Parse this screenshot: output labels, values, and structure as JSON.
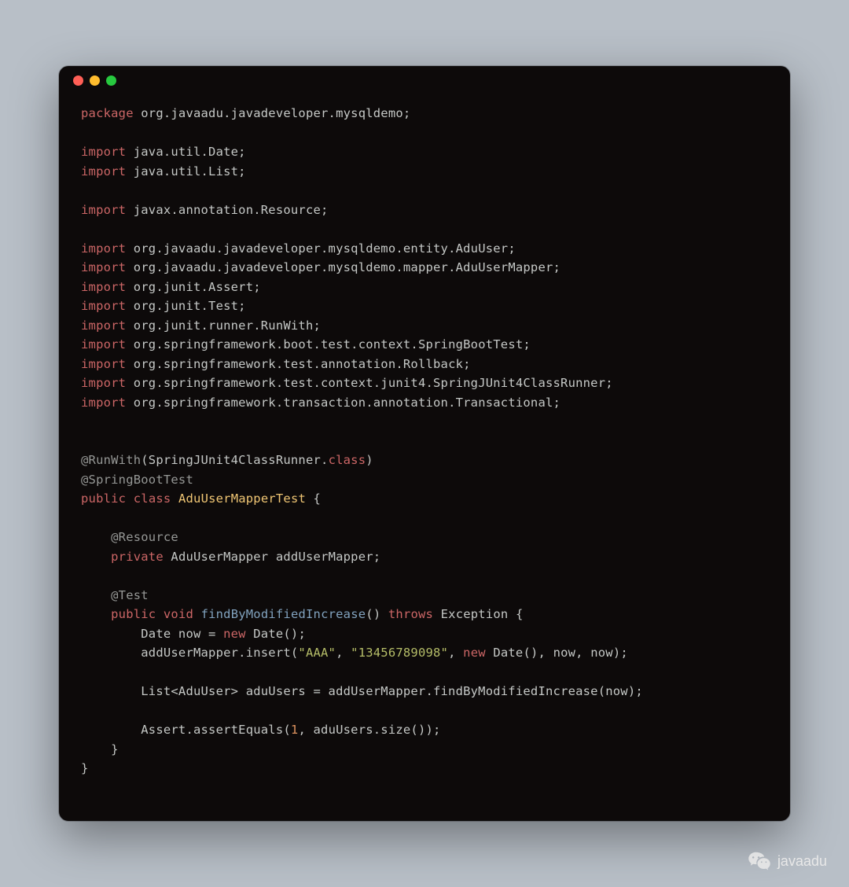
{
  "window": {
    "dots": [
      "red",
      "yellow",
      "green"
    ]
  },
  "code": {
    "lines": [
      [
        {
          "c": "kw-red",
          "t": "package"
        },
        {
          "c": "plain",
          "t": " org.javaadu.javadeveloper.mysqldemo;"
        }
      ],
      [],
      [
        {
          "c": "kw-red",
          "t": "import"
        },
        {
          "c": "plain",
          "t": " java.util.Date;"
        }
      ],
      [
        {
          "c": "kw-red",
          "t": "import"
        },
        {
          "c": "plain",
          "t": " java.util.List;"
        }
      ],
      [],
      [
        {
          "c": "kw-red",
          "t": "import"
        },
        {
          "c": "plain",
          "t": " javax.annotation.Resource;"
        }
      ],
      [],
      [
        {
          "c": "kw-red",
          "t": "import"
        },
        {
          "c": "plain",
          "t": " org.javaadu.javadeveloper.mysqldemo.entity.AduUser;"
        }
      ],
      [
        {
          "c": "kw-red",
          "t": "import"
        },
        {
          "c": "plain",
          "t": " org.javaadu.javadeveloper.mysqldemo.mapper.AduUserMapper;"
        }
      ],
      [
        {
          "c": "kw-red",
          "t": "import"
        },
        {
          "c": "plain",
          "t": " org.junit.Assert;"
        }
      ],
      [
        {
          "c": "kw-red",
          "t": "import"
        },
        {
          "c": "plain",
          "t": " org.junit.Test;"
        }
      ],
      [
        {
          "c": "kw-red",
          "t": "import"
        },
        {
          "c": "plain",
          "t": " org.junit.runner.RunWith;"
        }
      ],
      [
        {
          "c": "kw-red",
          "t": "import"
        },
        {
          "c": "plain",
          "t": " org.springframework.boot.test.context.SpringBootTest;"
        }
      ],
      [
        {
          "c": "kw-red",
          "t": "import"
        },
        {
          "c": "plain",
          "t": " org.springframework.test.annotation.Rollback;"
        }
      ],
      [
        {
          "c": "kw-red",
          "t": "import"
        },
        {
          "c": "plain",
          "t": " org.springframework.test.context.junit4.SpringJUnit4ClassRunner;"
        }
      ],
      [
        {
          "c": "kw-red",
          "t": "import"
        },
        {
          "c": "plain",
          "t": " org.springframework.transaction.annotation.Transactional;"
        }
      ],
      [],
      [],
      [
        {
          "c": "kw-dim",
          "t": "@RunWith"
        },
        {
          "c": "plain",
          "t": "(SpringJUnit4ClassRunner."
        },
        {
          "c": "kw-red",
          "t": "class"
        },
        {
          "c": "plain",
          "t": ")"
        }
      ],
      [
        {
          "c": "kw-dim",
          "t": "@SpringBootTest"
        }
      ],
      [
        {
          "c": "kw-red",
          "t": "public"
        },
        {
          "c": "plain",
          "t": " "
        },
        {
          "c": "kw-red",
          "t": "class"
        },
        {
          "c": "plain",
          "t": " "
        },
        {
          "c": "kw-yellow",
          "t": "AduUserMapperTest"
        },
        {
          "c": "plain",
          "t": " {"
        }
      ],
      [],
      [
        {
          "c": "plain",
          "t": "    "
        },
        {
          "c": "kw-dim",
          "t": "@Resource"
        }
      ],
      [
        {
          "c": "plain",
          "t": "    "
        },
        {
          "c": "kw-red",
          "t": "private"
        },
        {
          "c": "plain",
          "t": " AduUserMapper addUserMapper;"
        }
      ],
      [],
      [
        {
          "c": "plain",
          "t": "    "
        },
        {
          "c": "kw-dim",
          "t": "@Test"
        }
      ],
      [
        {
          "c": "plain",
          "t": "    "
        },
        {
          "c": "kw-red",
          "t": "public"
        },
        {
          "c": "plain",
          "t": " "
        },
        {
          "c": "kw-red",
          "t": "void"
        },
        {
          "c": "plain",
          "t": " "
        },
        {
          "c": "kw-blue",
          "t": "findByModifiedIncrease"
        },
        {
          "c": "plain",
          "t": "() "
        },
        {
          "c": "kw-red",
          "t": "throws"
        },
        {
          "c": "plain",
          "t": " Exception {"
        }
      ],
      [
        {
          "c": "plain",
          "t": "        Date now = "
        },
        {
          "c": "kw-red",
          "t": "new"
        },
        {
          "c": "plain",
          "t": " Date();"
        }
      ],
      [
        {
          "c": "plain",
          "t": "        addUserMapper.insert("
        },
        {
          "c": "kw-green",
          "t": "\"AAA\""
        },
        {
          "c": "plain",
          "t": ", "
        },
        {
          "c": "kw-green",
          "t": "\"13456789098\""
        },
        {
          "c": "plain",
          "t": ", "
        },
        {
          "c": "kw-red",
          "t": "new"
        },
        {
          "c": "plain",
          "t": " Date(), now, now);"
        }
      ],
      [],
      [
        {
          "c": "plain",
          "t": "        List<AduUser> aduUsers = addUserMapper.findByModifiedIncrease(now);"
        }
      ],
      [],
      [
        {
          "c": "plain",
          "t": "        Assert.assertEquals("
        },
        {
          "c": "kw-orange",
          "t": "1"
        },
        {
          "c": "plain",
          "t": ", aduUsers.size());"
        }
      ],
      [
        {
          "c": "plain",
          "t": "    }"
        }
      ],
      [
        {
          "c": "plain",
          "t": "}"
        }
      ]
    ]
  },
  "watermark": {
    "label": "javaadu"
  }
}
